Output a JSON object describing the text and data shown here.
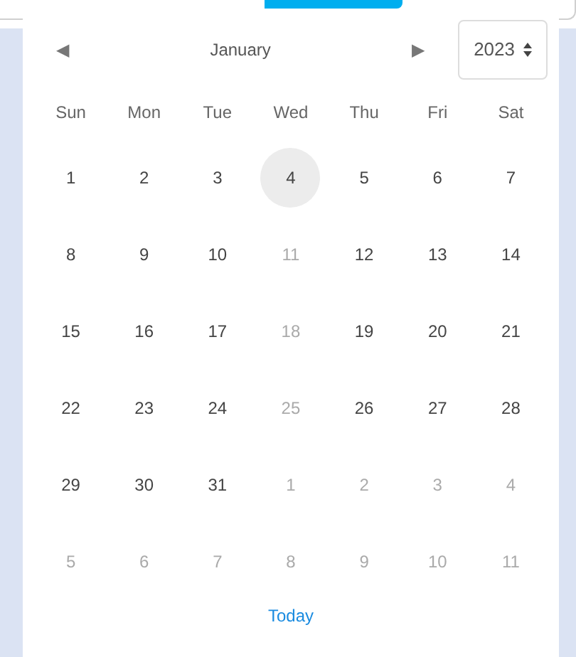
{
  "header": {
    "prev": "◀",
    "month": "January",
    "next": "▶",
    "year": "2023"
  },
  "weekdays": [
    "Sun",
    "Mon",
    "Tue",
    "Wed",
    "Thu",
    "Fri",
    "Sat"
  ],
  "days": [
    {
      "label": "1",
      "muted": false,
      "selected": false
    },
    {
      "label": "2",
      "muted": false,
      "selected": false
    },
    {
      "label": "3",
      "muted": false,
      "selected": false
    },
    {
      "label": "4",
      "muted": false,
      "selected": true
    },
    {
      "label": "5",
      "muted": false,
      "selected": false
    },
    {
      "label": "6",
      "muted": false,
      "selected": false
    },
    {
      "label": "7",
      "muted": false,
      "selected": false
    },
    {
      "label": "8",
      "muted": false,
      "selected": false
    },
    {
      "label": "9",
      "muted": false,
      "selected": false
    },
    {
      "label": "10",
      "muted": false,
      "selected": false
    },
    {
      "label": "11",
      "muted": true,
      "selected": false
    },
    {
      "label": "12",
      "muted": false,
      "selected": false
    },
    {
      "label": "13",
      "muted": false,
      "selected": false
    },
    {
      "label": "14",
      "muted": false,
      "selected": false
    },
    {
      "label": "15",
      "muted": false,
      "selected": false
    },
    {
      "label": "16",
      "muted": false,
      "selected": false
    },
    {
      "label": "17",
      "muted": false,
      "selected": false
    },
    {
      "label": "18",
      "muted": true,
      "selected": false
    },
    {
      "label": "19",
      "muted": false,
      "selected": false
    },
    {
      "label": "20",
      "muted": false,
      "selected": false
    },
    {
      "label": "21",
      "muted": false,
      "selected": false
    },
    {
      "label": "22",
      "muted": false,
      "selected": false
    },
    {
      "label": "23",
      "muted": false,
      "selected": false
    },
    {
      "label": "24",
      "muted": false,
      "selected": false
    },
    {
      "label": "25",
      "muted": true,
      "selected": false
    },
    {
      "label": "26",
      "muted": false,
      "selected": false
    },
    {
      "label": "27",
      "muted": false,
      "selected": false
    },
    {
      "label": "28",
      "muted": false,
      "selected": false
    },
    {
      "label": "29",
      "muted": false,
      "selected": false
    },
    {
      "label": "30",
      "muted": false,
      "selected": false
    },
    {
      "label": "31",
      "muted": false,
      "selected": false
    },
    {
      "label": "1",
      "muted": true,
      "selected": false
    },
    {
      "label": "2",
      "muted": true,
      "selected": false
    },
    {
      "label": "3",
      "muted": true,
      "selected": false
    },
    {
      "label": "4",
      "muted": true,
      "selected": false
    },
    {
      "label": "5",
      "muted": true,
      "selected": false
    },
    {
      "label": "6",
      "muted": true,
      "selected": false
    },
    {
      "label": "7",
      "muted": true,
      "selected": false
    },
    {
      "label": "8",
      "muted": true,
      "selected": false
    },
    {
      "label": "9",
      "muted": true,
      "selected": false
    },
    {
      "label": "10",
      "muted": true,
      "selected": false
    },
    {
      "label": "11",
      "muted": true,
      "selected": false
    }
  ],
  "footer": {
    "today": "Today"
  }
}
